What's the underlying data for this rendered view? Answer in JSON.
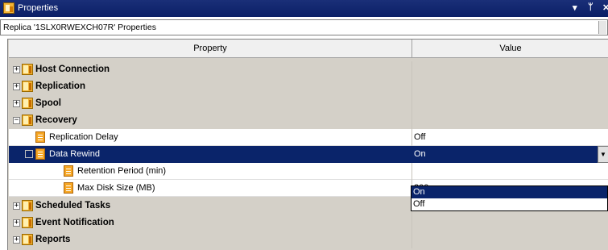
{
  "window": {
    "title": "Properties",
    "pin_glyph": "▾",
    "dock_glyph": "ᛘ",
    "close_glyph": "✕"
  },
  "header": {
    "text": "Replica '1SLX0RWEXCH07R' Properties"
  },
  "columns": {
    "property": "Property",
    "value": "Value"
  },
  "categories": [
    {
      "label": "Host Connection",
      "expander": "+"
    },
    {
      "label": "Replication",
      "expander": "+"
    },
    {
      "label": "Spool",
      "expander": "+"
    },
    {
      "label": "Recovery",
      "expander": "−"
    }
  ],
  "recovery_items": [
    {
      "label": "Replication Delay",
      "value": "Off"
    },
    {
      "label": "Data Rewind",
      "value": "On",
      "expander": "−"
    },
    {
      "label": "Retention Period (min)",
      "value": ""
    },
    {
      "label": "Max Disk Size (MB)",
      "value": "200"
    }
  ],
  "trailing_categories": [
    {
      "label": "Scheduled Tasks",
      "expander": "+"
    },
    {
      "label": "Event Notification",
      "expander": "+"
    },
    {
      "label": "Reports",
      "expander": "+"
    }
  ],
  "dropdown": {
    "options": [
      "On",
      "Off"
    ],
    "selected": "On",
    "arrow": "▼"
  }
}
